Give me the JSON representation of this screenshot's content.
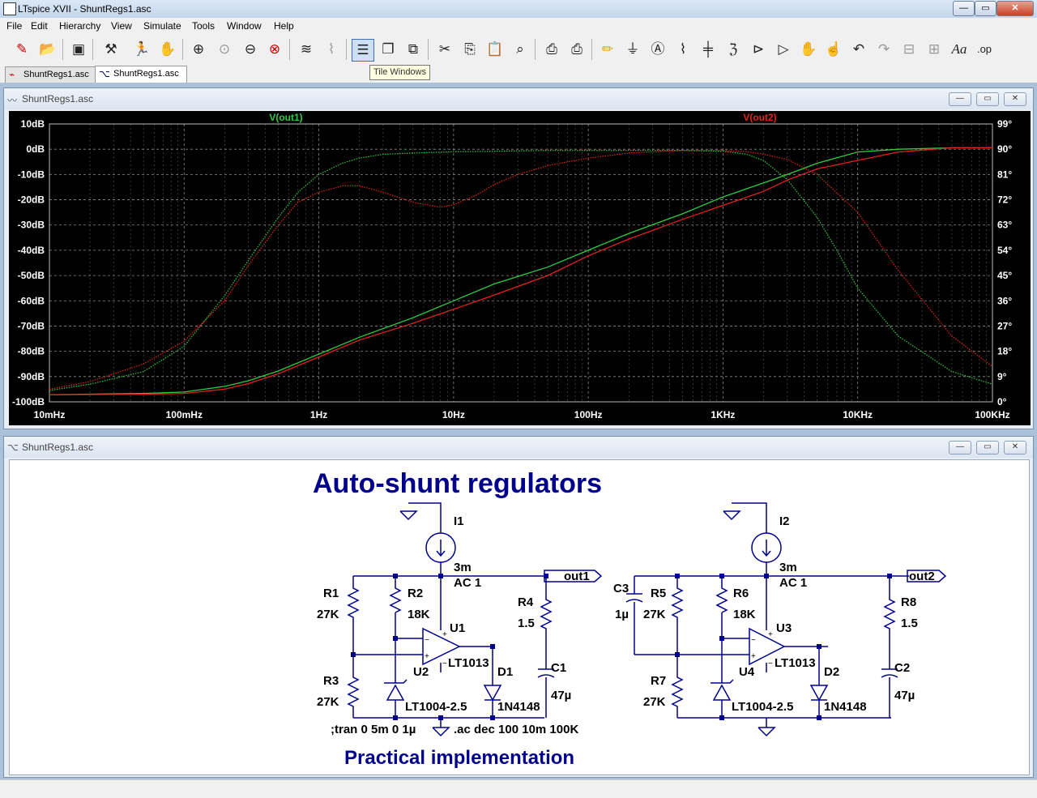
{
  "app": {
    "title": "LTspice XVII - ShuntRegs1.asc"
  },
  "window_controls": {
    "minimize": "—",
    "restore": "▭",
    "close": "✕"
  },
  "menu": [
    "File",
    "Edit",
    "Hierarchy",
    "View",
    "Simulate",
    "Tools",
    "Window",
    "Help"
  ],
  "toolbar": {
    "tooltip": "Tile Windows",
    "icons": [
      "new-schematic-icon",
      "open-icon",
      "save-icon",
      "control-panel-icon",
      "run-icon",
      "halt-icon",
      "zoom-in-icon",
      "zoom-full-icon",
      "zoom-out-icon",
      "zoom-cancel-icon",
      "autorange-icon",
      "pick-visible-traces-icon",
      "tile-windows-icon",
      "cascade-windows-icon",
      "close-window-icon",
      "cut-icon",
      "copy-icon",
      "paste-icon",
      "find-icon",
      "print-icon",
      "print-setup-icon",
      "draw-wire-icon",
      "ground-icon",
      "label-net-icon",
      "resistor-icon",
      "capacitor-icon",
      "inductor-icon",
      "diode-icon",
      "component-icon",
      "move-icon",
      "drag-icon",
      "undo-icon",
      "redo-icon",
      "rotate-icon",
      "mirror-icon",
      "text-icon",
      "spice-directive-icon"
    ]
  },
  "tabs": [
    {
      "label": "ShuntRegs1.asc",
      "icon": "waveform-icon"
    },
    {
      "label": "ShuntRegs1.asc",
      "icon": "schematic-icon",
      "active": true
    }
  ],
  "plot_window": {
    "title": "ShuntRegs1.asc"
  },
  "schematic_window": {
    "title": "ShuntRegs1.asc"
  },
  "chart_data": {
    "type": "line",
    "xscale": "log",
    "xlim": [
      0.01,
      100000
    ],
    "x_ticks": [
      "10mHz",
      "100mHz",
      "1Hz",
      "10Hz",
      "100Hz",
      "1KHz",
      "10KHz",
      "100KHz"
    ],
    "y_left_ticks": [
      "10dB",
      "0dB",
      "-10dB",
      "-20dB",
      "-30dB",
      "-40dB",
      "-50dB",
      "-60dB",
      "-70dB",
      "-80dB",
      "-90dB",
      "-100dB"
    ],
    "y_right_ticks": [
      "99°",
      "90°",
      "81°",
      "72°",
      "63°",
      "54°",
      "45°",
      "36°",
      "27°",
      "18°",
      "9°",
      "0°"
    ],
    "ylim_db": [
      -100,
      10
    ],
    "ylim_phase": [
      0,
      99
    ],
    "grid": true,
    "background": "#000000",
    "series": [
      {
        "name": "V(out1)",
        "color": "#2ecc40",
        "kind": "magnitude",
        "x": [
          0.01,
          0.02,
          0.05,
          0.1,
          0.2,
          0.3,
          0.5,
          0.7,
          1,
          1.5,
          2,
          3,
          5,
          10,
          20,
          50,
          100,
          200,
          500,
          1000,
          1500,
          2000,
          3000,
          5000,
          7000,
          10000,
          20000,
          50000,
          100000
        ],
        "y": [
          -95.5,
          -93,
          -88,
          -78,
          -58,
          -44,
          -27,
          -17,
          -10,
          -5.5,
          -3.5,
          -2,
          -1.5,
          -1,
          -0.8,
          -0.5,
          -0.5,
          -0.5,
          -0.5,
          -0.8,
          -2,
          -4.5,
          -12,
          -27,
          -40,
          -55,
          -74,
          -88,
          -93
        ]
      },
      {
        "name": "V(out2)",
        "color": "#e0241b",
        "kind": "magnitude",
        "x": [
          0.01,
          0.02,
          0.05,
          0.1,
          0.2,
          0.3,
          0.5,
          0.7,
          1,
          1.5,
          2,
          3,
          5,
          8,
          10,
          15,
          20,
          30,
          50,
          100,
          200,
          500,
          1000,
          1500,
          2000,
          3000,
          5000,
          10000,
          20000,
          50000,
          100000
        ],
        "y": [
          -95,
          -92,
          -85,
          -76,
          -60,
          -46,
          -30,
          -21,
          -17,
          -14.5,
          -14.5,
          -17,
          -21,
          -23,
          -22,
          -18,
          -14,
          -10,
          -6.5,
          -3.5,
          -1.5,
          -0.5,
          -0.5,
          -1,
          -2,
          -4,
          -10,
          -25,
          -48,
          -74,
          -86
        ]
      },
      {
        "name": "V(out1) phase",
        "color": "#2ecc40",
        "kind": "phase",
        "x": [
          0.01,
          0.05,
          0.1,
          0.2,
          0.3,
          0.5,
          1,
          2,
          5,
          10,
          20,
          50,
          100,
          200,
          500,
          1000,
          2000,
          3000,
          5000,
          10000,
          20000,
          50000,
          100000
        ],
        "y": [
          2.5,
          3,
          3.5,
          5.5,
          7.5,
          11,
          17,
          23,
          30,
          36,
          42,
          48,
          54,
          60,
          67,
          73,
          78,
          81,
          85,
          89,
          90,
          90.5,
          90.5
        ]
      },
      {
        "name": "V(out2) phase",
        "color": "#e0241b",
        "kind": "phase",
        "x": [
          0.01,
          0.05,
          0.1,
          0.2,
          0.3,
          0.5,
          1,
          2,
          5,
          10,
          20,
          50,
          100,
          200,
          500,
          1000,
          2000,
          3000,
          5000,
          10000,
          20000,
          50000,
          100000
        ],
        "y": [
          2.5,
          2.7,
          3,
          4.5,
          6.5,
          10,
          16,
          22,
          28,
          33,
          38,
          45,
          52,
          58,
          65,
          70,
          75,
          79,
          83,
          86,
          89,
          90.5,
          90.5
        ]
      }
    ]
  },
  "schematic": {
    "title": "Auto-shunt regulators",
    "subtitle": "Practical implementation",
    "directives": [
      ";tran 0 5m 0 1µ",
      ".ac dec 100 10m 100K"
    ],
    "left": {
      "source": {
        "ref": "I1",
        "value": "3m",
        "ac": "AC 1"
      },
      "out_label": "out1",
      "r1": {
        "ref": "R1",
        "value": "27K"
      },
      "r2": {
        "ref": "R2",
        "value": "18K"
      },
      "r3": {
        "ref": "R3",
        "value": "27K"
      },
      "r4": {
        "ref": "R4",
        "value": "1.5"
      },
      "c1": {
        "ref": "C1",
        "value": "47µ"
      },
      "opamp": {
        "ref": "U1",
        "part": "LT1013"
      },
      "zener": {
        "ref": "U2",
        "part": "LT1004-2.5"
      },
      "diode": {
        "ref": "D1",
        "part": "1N4148"
      }
    },
    "right": {
      "source": {
        "ref": "I2",
        "value": "3m",
        "ac": "AC 1"
      },
      "out_label": "out2",
      "c3": {
        "ref": "C3",
        "value": "1µ"
      },
      "r5": {
        "ref": "R5",
        "value": "27K"
      },
      "r6": {
        "ref": "R6",
        "value": "18K"
      },
      "r7": {
        "ref": "R7",
        "value": "27K"
      },
      "r8": {
        "ref": "R8",
        "value": "1.5"
      },
      "c2": {
        "ref": "C2",
        "value": "47µ"
      },
      "opamp": {
        "ref": "U3",
        "part": "LT1013"
      },
      "zener": {
        "ref": "U4",
        "part": "LT1004-2.5"
      },
      "diode": {
        "ref": "D2",
        "part": "1N4148"
      }
    }
  }
}
